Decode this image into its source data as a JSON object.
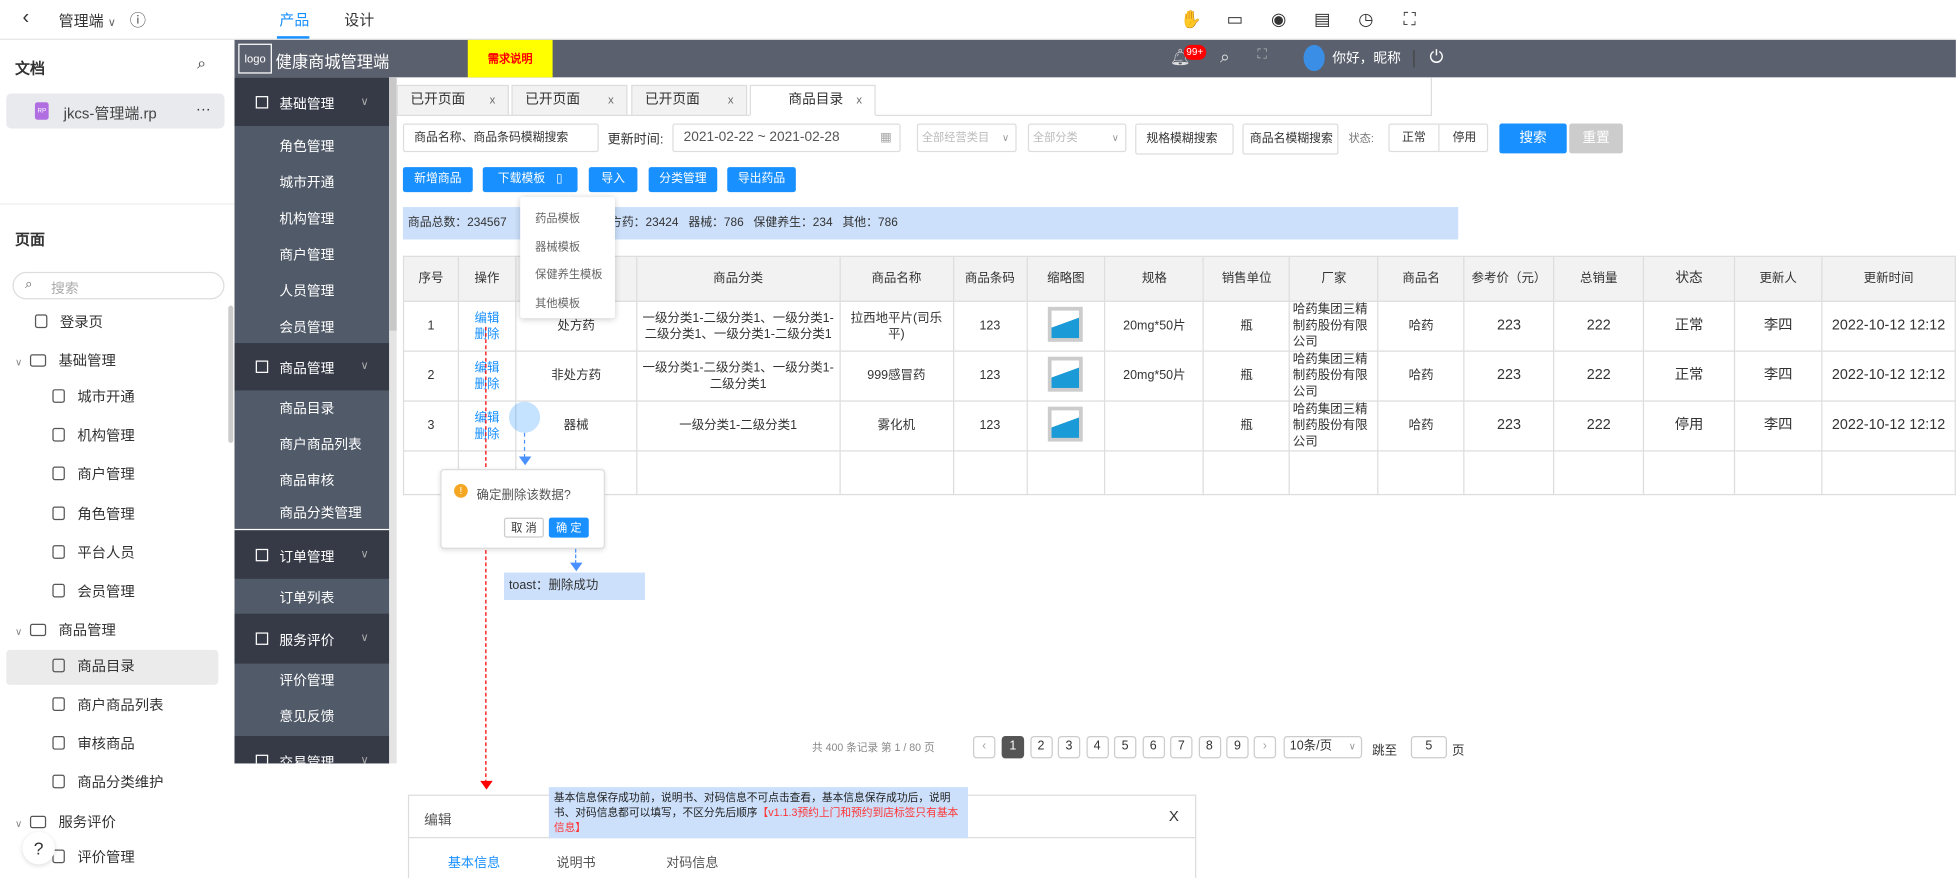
{
  "topbar": {
    "back": "‹",
    "project": "管理端",
    "project_chevron": "∨",
    "info": "ⓘ",
    "tabs": [
      {
        "label": "产品",
        "active": true
      },
      {
        "label": "设计",
        "active": false
      }
    ],
    "tools": [
      "hand-icon",
      "comment-icon",
      "eye-icon",
      "notes-icon",
      "history-icon",
      "fullscreen-icon"
    ]
  },
  "left": {
    "docs_title": "文档",
    "file": {
      "badge": "RP",
      "name": "jkcs-管理端.rp",
      "more": "···"
    },
    "pages_title": "页面",
    "search_placeholder": "搜索",
    "tree": [
      {
        "label": "登录页",
        "type": "page",
        "level": 0
      },
      {
        "label": "基础管理",
        "type": "folder",
        "level": 0
      },
      {
        "label": "城市开通",
        "type": "page",
        "level": 1
      },
      {
        "label": "机构管理",
        "type": "page",
        "level": 1
      },
      {
        "label": "商户管理",
        "type": "page",
        "level": 1
      },
      {
        "label": "角色管理",
        "type": "page",
        "level": 1
      },
      {
        "label": "平台人员",
        "type": "page",
        "level": 1
      },
      {
        "label": "会员管理",
        "type": "page",
        "level": 1
      },
      {
        "label": "商品管理",
        "type": "folder",
        "level": 0
      },
      {
        "label": "商品目录",
        "type": "page",
        "level": 1,
        "selected": true
      },
      {
        "label": "商户商品列表",
        "type": "page",
        "level": 1
      },
      {
        "label": "审核商品",
        "type": "page",
        "level": 1
      },
      {
        "label": "商品分类维护",
        "type": "page",
        "level": 1
      },
      {
        "label": "服务评价",
        "type": "folder",
        "level": 0
      },
      {
        "label": "评价管理",
        "type": "page",
        "level": 1
      }
    ],
    "help": "?"
  },
  "header": {
    "logo": "logo",
    "title": "健康商城管理端",
    "req_note": "需求说明",
    "badge": "99+",
    "greeting": "你好，昵称"
  },
  "sidebar": {
    "groups": [
      {
        "label": "基础管理",
        "items": [
          "角色管理",
          "城市开通",
          "机构管理",
          "商户管理",
          "人员管理",
          "会员管理"
        ]
      },
      {
        "label": "商品管理",
        "items": [
          "商品目录",
          "商户商品列表",
          "商品审核",
          "商品分类管理"
        ]
      },
      {
        "label": "订单管理",
        "items": [
          "订单列表"
        ]
      },
      {
        "label": "服务评价",
        "items": [
          "评价管理",
          "意见反馈"
        ]
      },
      {
        "label": "交易管理",
        "items": []
      }
    ]
  },
  "tabs": [
    {
      "label": "已开页面",
      "close": "x"
    },
    {
      "label": "已开页面",
      "close": "x"
    },
    {
      "label": "已开页面",
      "close": "x"
    },
    {
      "label": "商品目录",
      "close": "x",
      "active": true
    }
  ],
  "filters": {
    "keyword_placeholder": "商品名称、商品条码模糊搜索",
    "date_label": "更新时间:",
    "date_range": "2021-02-22 ~ 2021-02-28",
    "category_type": "全部经营类目",
    "category": "全部分类",
    "spec_placeholder": "规格模糊搜索",
    "name_placeholder": "商品名模糊搜索",
    "status_label": "状态:",
    "status_options": [
      "正常",
      "停用"
    ],
    "search": "搜索",
    "reset": "重置"
  },
  "actions": {
    "add": "新增商品",
    "download": "下载模板",
    "import": "导入",
    "category": "分类管理",
    "export": "导出药品"
  },
  "download_menu": [
    "药品模板",
    "器械模板",
    "保健养生模板",
    "其他模板"
  ],
  "stats": {
    "left": "商品总数：234567    处",
    "right": "方药：23424   器械：786   保健养生：234   其他：786"
  },
  "table": {
    "headers": [
      "序号",
      "操作",
      "",
      "商品分类",
      "商品名称",
      "商品条码",
      "缩略图",
      "规格",
      "销售单位",
      "厂家",
      "商品名",
      "参考价（元）",
      "总销量",
      "状态",
      "更新人",
      "更新时间"
    ],
    "edit": "编辑",
    "delete": "删除",
    "rows": [
      [
        "1",
        "",
        "处方药",
        "一级分类1-二级分类1、一级分类1-二级分类1、一级分类1-二级分类1",
        "拉西地平片(司乐平)",
        "123",
        "",
        "20mg*50片",
        "瓶",
        "哈药集团三精制药股份有限公司",
        "哈药",
        "223",
        "222",
        "正常",
        "李四",
        "2022-10-12  12:12"
      ],
      [
        "2",
        "",
        "非处方药",
        "一级分类1-二级分类1、一级分类1-二级分类1",
        "999感冒药",
        "123",
        "",
        "20mg*50片",
        "瓶",
        "哈药集团三精制药股份有限公司",
        "哈药",
        "223",
        "222",
        "正常",
        "李四",
        "2022-10-12  12:12"
      ],
      [
        "3",
        "",
        "器械",
        "一级分类1-二级分类1",
        "雾化机",
        "123",
        "",
        "",
        "瓶",
        "哈药集团三精制药股份有限公司",
        "哈药",
        "223",
        "222",
        "停用",
        "李四",
        "2022-10-12  12:12"
      ]
    ]
  },
  "popconfirm": {
    "message": "确定删除该数据?",
    "cancel": "取 消",
    "ok": "确 定"
  },
  "toast": "toast：删除成功",
  "pagination": {
    "summary": "共 400 条记录 第 1 / 80 页",
    "prev": "‹",
    "next": "›",
    "pages": [
      "1",
      "2",
      "3",
      "4",
      "5",
      "6",
      "7",
      "8",
      "9"
    ],
    "current": "1",
    "page_size": "10条/页",
    "jump_label": "跳至",
    "jump_value": "5",
    "page_unit": "页"
  },
  "edit_panel": {
    "title": "编辑",
    "close": "X",
    "tabs": [
      "基本信息",
      "说明书",
      "对码信息"
    ],
    "active_tab": "基本信息",
    "note": "基本信息保存成功前，说明书、对码信息不可点击查看，基本信息保存成功后，说明书、对码信息都可以填写，不区分先后顺序",
    "note_red": "【v1.1.3预约上门和预约到店标签只有基本信息】"
  },
  "colors": {
    "primary": "#1890ff",
    "header": "#5a606d",
    "sidebar_group": "#363a47",
    "sidebar_item": "#515a68",
    "note_bg": "#cce0fb",
    "annotation_red": "#ff0000",
    "req_note_bg": "#ffff00"
  }
}
